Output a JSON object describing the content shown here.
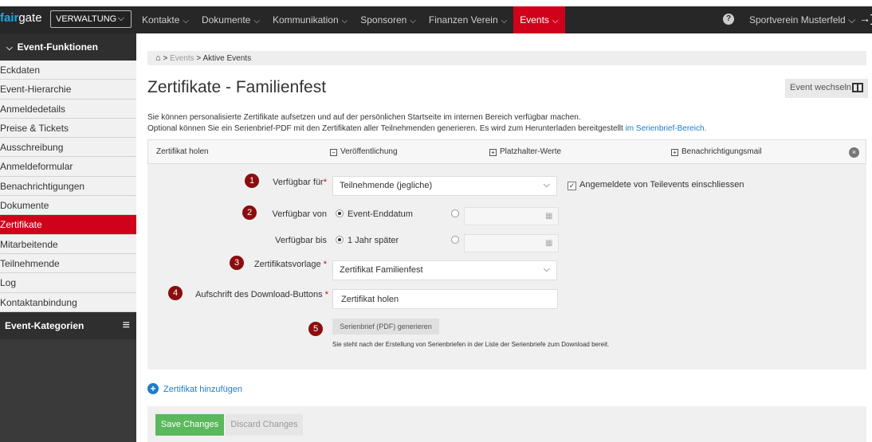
{
  "topbar": {
    "logo_a": "fair",
    "logo_b": "gate",
    "admin_button": "VERWALTUNG",
    "nav": [
      "Kontakte",
      "Dokumente",
      "Kommunikation",
      "Sponsoren",
      "Finanzen Verein",
      "Events"
    ],
    "active_nav": "Events",
    "help": "?",
    "club": "Sportverein Musterfeld",
    "chevron": "⌵",
    "logout": "→]"
  },
  "sidebar": {
    "section1": "Event-Funktionen",
    "items": [
      "Eckdaten",
      "Event-Hierarchie",
      "Anmeldedetails",
      "Preise & Tickets",
      "Ausschreibung",
      "Anmeldeformular",
      "Benachrichtigungen",
      "Dokumente",
      "Zertifikate",
      "Mitarbeitende",
      "Teilnehmende",
      "Log",
      "Kontaktanbindung"
    ],
    "active_item": "Zertifikate",
    "section2": "Event-Kategorien"
  },
  "breadcrumb": {
    "home": "⌂",
    "level1": "Events",
    "sep": ">",
    "level2": "Aktive Events"
  },
  "page": {
    "title": "Zertifikate - Familienfest",
    "switch_button": "Event wechseln",
    "desc_line1": "Sie können personalisierte Zertifikate aufsetzen und auf der persönlichen Startseite im internen Bereich verfügbar machen.",
    "desc_line2": "Optional können Sie ein Serienbrief-PDF mit den Zertifikaten aller Teilnehmenden generieren. Es wird zum Herunterladen bereitgestellt",
    "desc_link": "im Serienbrief-Bereich."
  },
  "tabs": {
    "title": "Zertifikat holen",
    "t1": "Veröffentlichung",
    "t2": "Platzhalter-Werte",
    "t3": "Benachrichtigungsmail",
    "minus": "−",
    "plus": "+",
    "close": "×"
  },
  "form": {
    "n1": "1",
    "n2": "2",
    "n3": "3",
    "n4": "4",
    "n5": "5",
    "available_for_label": "Verfügbar für",
    "available_for_value": "Teilnehmende (jegliche)",
    "include_sub_label": "Angemeldete von Teilevents einschliessen",
    "include_sub_checked": true,
    "available_from_label": "Verfügbar von",
    "available_from_option": "Event-Enddatum",
    "available_until_label": "Verfügbar bis",
    "available_until_option": "1 Jahr später",
    "template_label": "Zertifikatsvorlage",
    "template_value": "Zertifikat Familienfest",
    "download_label": "Aufschrift des Download-Buttons",
    "download_value": "Zertifikat holen",
    "req": "*",
    "check": "✓",
    "generate_button": "Serienbrief (PDF) generieren",
    "generate_note": "Sie steht nach der Erstellung von Serienbriefen in der Liste der Serienbriefe zum Download bereit."
  },
  "add_certificate": "Zertifikat hinzufügen",
  "add_plus": "+",
  "footer": {
    "save": "Save Changes",
    "discard": "Discard Changes"
  },
  "icons": {
    "calendar": "▦",
    "menu": "≡"
  },
  "colors": {
    "accent": "#d0021b",
    "badge": "#8b0d0d",
    "link": "#1e7ec8",
    "save": "#5cb85c"
  }
}
